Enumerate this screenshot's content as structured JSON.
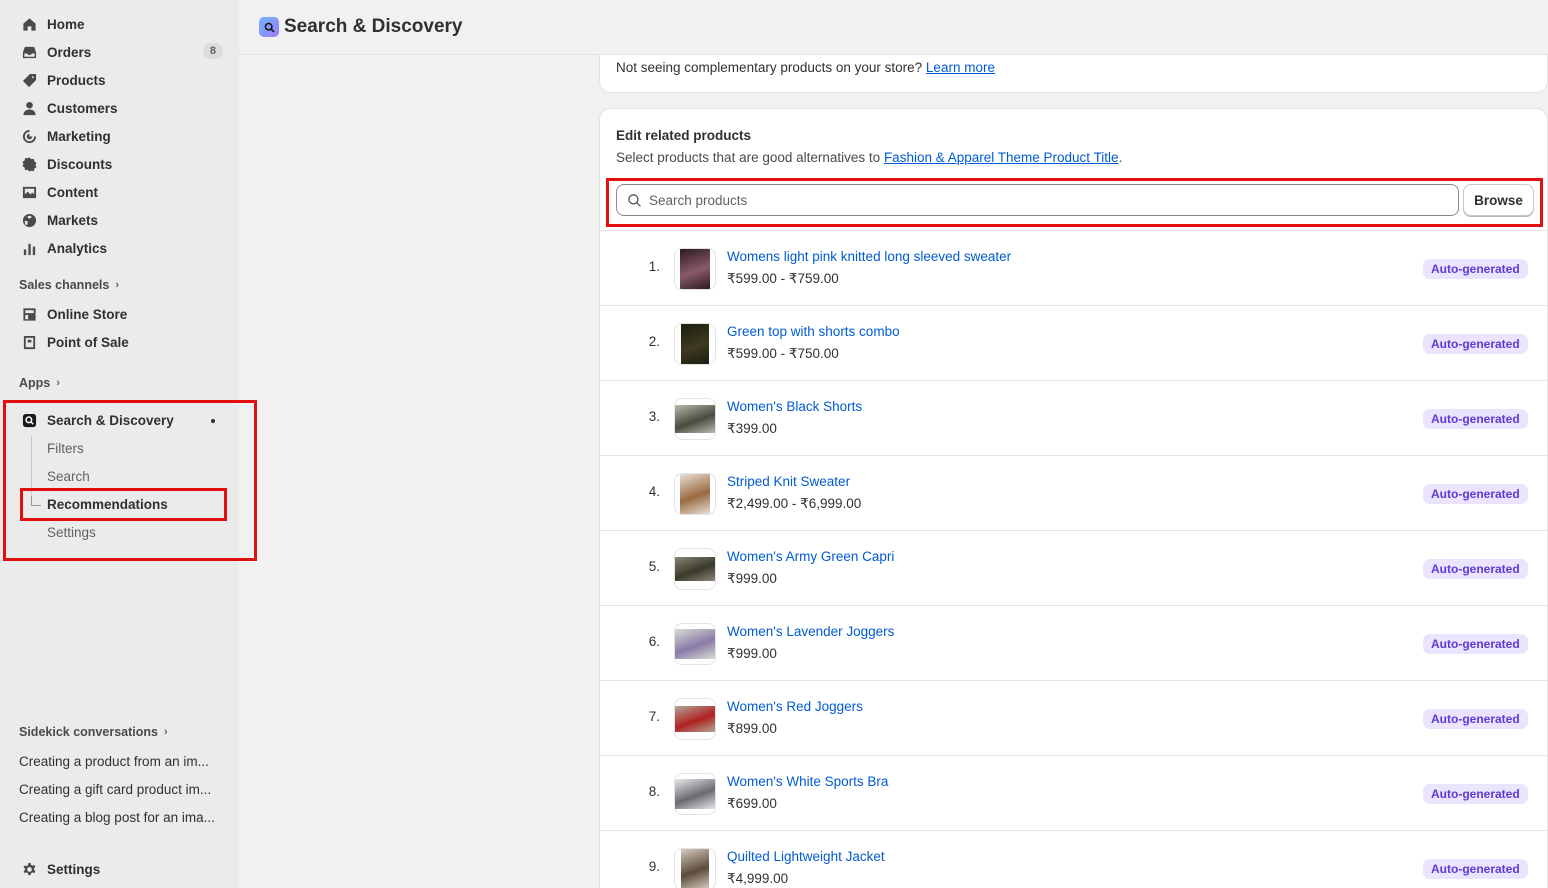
{
  "sidebar": {
    "nav": [
      {
        "label": "Home",
        "icon": "home-icon"
      },
      {
        "label": "Orders",
        "icon": "orders-icon",
        "badge": "8"
      },
      {
        "label": "Products",
        "icon": "tag-icon"
      },
      {
        "label": "Customers",
        "icon": "person-icon"
      },
      {
        "label": "Marketing",
        "icon": "target-icon"
      },
      {
        "label": "Discounts",
        "icon": "discount-icon"
      },
      {
        "label": "Content",
        "icon": "image-icon"
      },
      {
        "label": "Markets",
        "icon": "globe-icon"
      },
      {
        "label": "Analytics",
        "icon": "bar-chart-icon"
      }
    ],
    "sales_channels_label": "Sales channels",
    "channels": [
      {
        "label": "Online Store",
        "icon": "store-icon"
      },
      {
        "label": "Point of Sale",
        "icon": "pos-icon"
      }
    ],
    "apps_label": "Apps",
    "app": {
      "label": "Search & Discovery",
      "subitems": [
        "Filters",
        "Search",
        "Recommendations",
        "Settings"
      ],
      "active": "Recommendations"
    },
    "sidekick_label": "Sidekick conversations",
    "sidekick": [
      "Creating a product from an im...",
      "Creating a gift card product im...",
      "Creating a blog post for an ima..."
    ],
    "settings_label": "Settings"
  },
  "topbar": {
    "title": "Search & Discovery"
  },
  "notice": {
    "text": "Not seeing complementary products on your store?",
    "link": "Learn more"
  },
  "related": {
    "title": "Edit related products",
    "subtitle": "Select products that are good alternatives to",
    "subtitle_link": "Fashion & Apparel Theme Product Title",
    "subtitle_end": ".",
    "search_placeholder": "Search products",
    "browse_label": "Browse",
    "products": [
      {
        "num": "1.",
        "name": "Womens light pink knitted long sleeved sweater",
        "price": "₹599.00 - ₹759.00",
        "tag": "Auto-generated"
      },
      {
        "num": "2.",
        "name": "Green top with shorts combo",
        "price": "₹599.00 - ₹750.00",
        "tag": "Auto-generated"
      },
      {
        "num": "3.",
        "name": "Women's Black Shorts",
        "price": "₹399.00",
        "tag": "Auto-generated"
      },
      {
        "num": "4.",
        "name": "Striped Knit Sweater",
        "price": "₹2,499.00 - ₹6,999.00",
        "tag": "Auto-generated"
      },
      {
        "num": "5.",
        "name": "Women's Army Green Capri",
        "price": "₹999.00",
        "tag": "Auto-generated"
      },
      {
        "num": "6.",
        "name": "Women's Lavender Joggers",
        "price": "₹999.00",
        "tag": "Auto-generated"
      },
      {
        "num": "7.",
        "name": "Women's Red Joggers",
        "price": "₹899.00",
        "tag": "Auto-generated"
      },
      {
        "num": "8.",
        "name": "Women's White Sports Bra",
        "price": "₹699.00",
        "tag": "Auto-generated"
      },
      {
        "num": "9.",
        "name": "Quilted Lightweight Jacket",
        "price": "₹4,999.00",
        "tag": "Auto-generated"
      }
    ]
  },
  "colors": {
    "highlight": "#e01010",
    "link": "#005bd3",
    "tag_bg": "#ebe4ff",
    "tag_text": "#5b3bd6"
  }
}
